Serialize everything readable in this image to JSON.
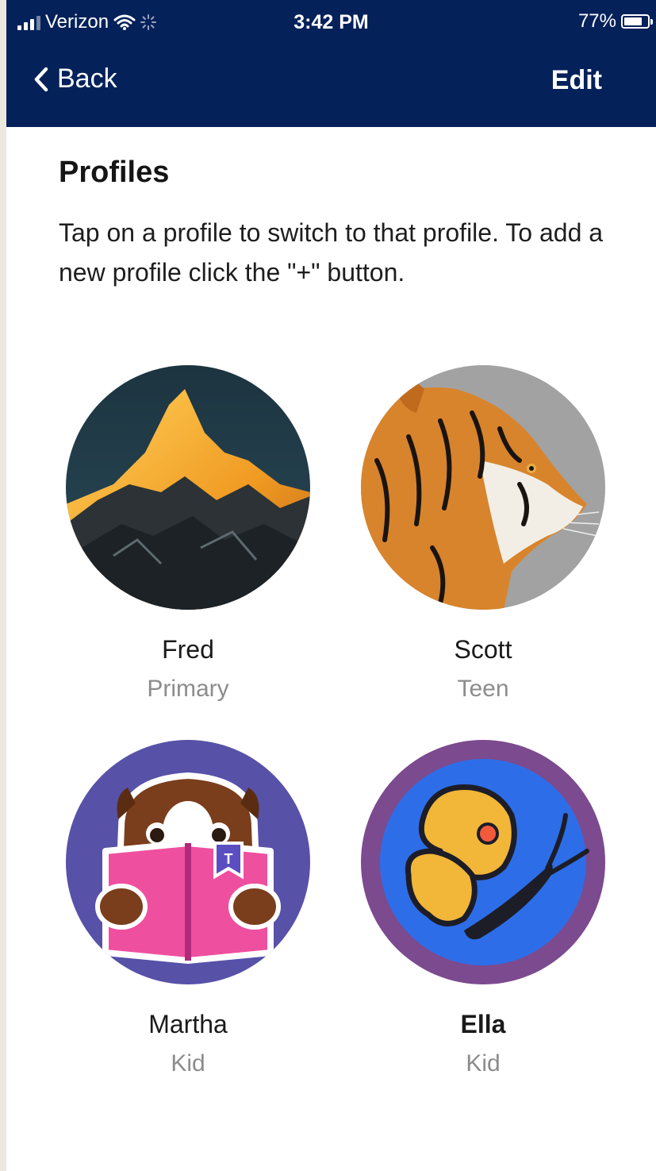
{
  "status_bar": {
    "carrier": "Verizon",
    "time": "3:42 PM",
    "battery": "77%",
    "battery_level": 0.77
  },
  "nav": {
    "back_label": "Back",
    "edit_label": "Edit"
  },
  "page": {
    "title": "Profiles",
    "description": "Tap on a profile to switch to that profile. To add a new profile click the \"+\" button."
  },
  "profiles": [
    {
      "name": "Fred",
      "role": "Primary",
      "avatar_icon": "mountain-avatar-icon"
    },
    {
      "name": "Scott",
      "role": "Teen",
      "avatar_icon": "tiger-avatar-icon"
    },
    {
      "name": "Martha",
      "role": "Kid",
      "avatar_icon": "reading-animal-avatar-icon"
    },
    {
      "name": "Ella",
      "role": "Kid",
      "avatar_icon": "butterfly-avatar-icon"
    }
  ],
  "colors": {
    "header_bg": "#05215a",
    "role_text": "#8c8c8c"
  }
}
